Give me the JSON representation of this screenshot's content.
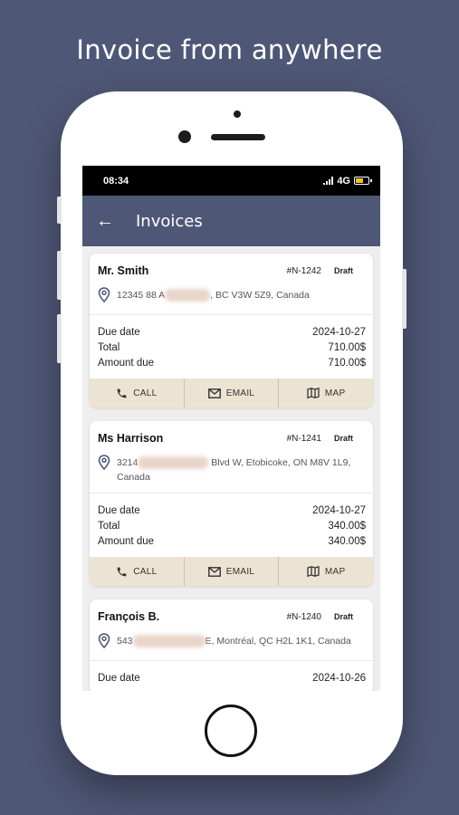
{
  "headline": "Invoice from anywhere",
  "statusbar": {
    "time": "08:34",
    "network": "4G"
  },
  "appbar": {
    "title": "Invoices"
  },
  "labels": {
    "due_date": "Due date",
    "total": "Total",
    "amount_due": "Amount due"
  },
  "actions": {
    "call": "CALL",
    "email": "EMAIL",
    "map": "MAP"
  },
  "invoices": [
    {
      "client": "Mr. Smith",
      "number": "#N-1242",
      "status": "Draft",
      "address_start": "12345 88 A",
      "address_end": ", BC V3W 5Z9, Canada",
      "address_line2": "",
      "due_date": "2024-10-27",
      "total": "710.00$",
      "amount_due": "710.00$"
    },
    {
      "client": "Ms Harrison",
      "number": "#N-1241",
      "status": "Draft",
      "address_start": "3214",
      "address_end": " Blvd W, Etobicoke, ON M8V 1L9,",
      "address_line2": "Canada",
      "due_date": "2024-10-27",
      "total": "340.00$",
      "amount_due": "340.00$"
    },
    {
      "client": "François B.",
      "number": "#N-1240",
      "status": "Draft",
      "address_start": "543",
      "address_end": "E, Montréal, QC H2L 1K1, Canada",
      "address_line2": "",
      "due_date": "2024-10-26",
      "total": "",
      "amount_due": ""
    }
  ],
  "colors": {
    "brand": "#4f5776",
    "action_bar": "#ece3d2",
    "battery": "#f2c230"
  }
}
